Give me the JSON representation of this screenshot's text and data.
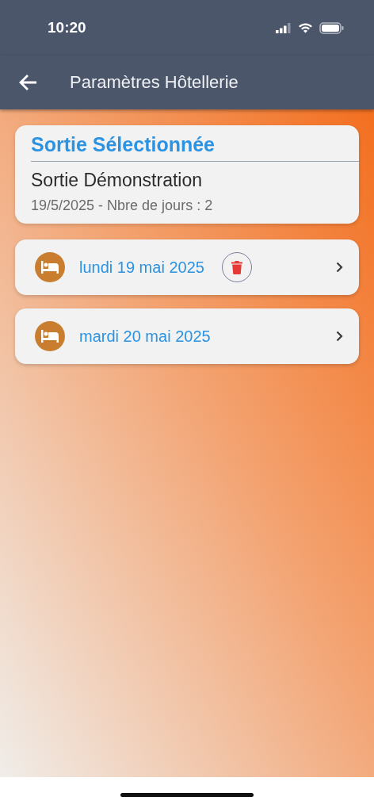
{
  "status_bar": {
    "time": "10:20"
  },
  "app_bar": {
    "title": "Paramètres Hôtellerie"
  },
  "selected_outing": {
    "heading": "Sortie Sélectionnée",
    "name": "Sortie Démonstration",
    "info": "19/5/2025 - Nbre de jours : 2"
  },
  "days": [
    {
      "label": "lundi 19 mai 2025",
      "deletable": true
    },
    {
      "label": "mardi 20 mai 2025",
      "deletable": false
    }
  ]
}
